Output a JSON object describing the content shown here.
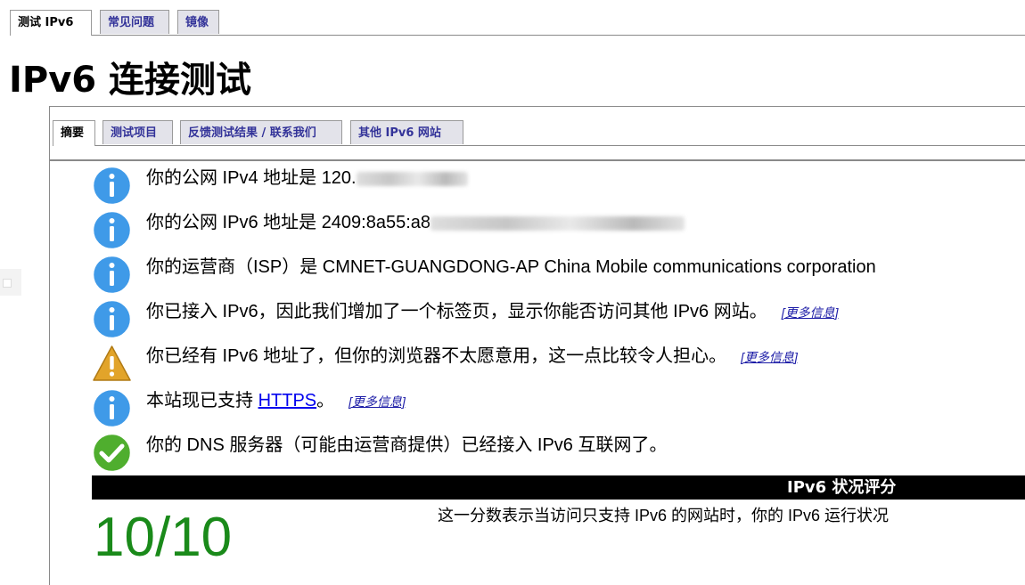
{
  "top_tabs": [
    {
      "label": "测试 IPv6",
      "active": true
    },
    {
      "label": "常见问题",
      "active": false
    },
    {
      "label": "镜像",
      "active": false
    }
  ],
  "title": "IPv6 连接测试",
  "inner_tabs": [
    {
      "label": "摘要",
      "active": true
    },
    {
      "label": "测试项目",
      "active": false
    },
    {
      "label": "反馈测试结果 / 联系我们",
      "active": false
    },
    {
      "label": "其他 IPv6 网站",
      "active": false
    }
  ],
  "messages": [
    {
      "icon": "info-icon",
      "text": "你的公网 IPv4 地址是 120."
    },
    {
      "icon": "info-icon",
      "text": "你的公网 IPv6 地址是 2409:8a55:a8"
    },
    {
      "icon": "info-icon",
      "text": "你的运营商（ISP）是 CMNET-GUANGDONG-AP China Mobile communications corporation"
    },
    {
      "icon": "info-icon",
      "text": "你已接入 IPv6，因此我们增加了一个标签页，显示你能否访问其他 IPv6 网站。",
      "more": "[更多信息]"
    },
    {
      "icon": "warning-icon",
      "text": "你已经有 IPv6 地址了，但你的浏览器不太愿意用，这一点比较令人担心。",
      "more": "[更多信息]"
    },
    {
      "icon": "info-icon",
      "text_before": "本站现已支持 ",
      "link": "HTTPS",
      "text_after": "。",
      "more": "[更多信息]"
    },
    {
      "icon": "check-icon",
      "text": "你的 DNS 服务器（可能由运营商提供）已经接入 IPv6 互联网了。"
    }
  ],
  "score": {
    "heading": "IPv6 状况评分",
    "value": "10/10",
    "description": "这一分数表示当访问只支持 IPv6 的网站时，你的 IPv6 运行状况"
  },
  "colors": {
    "tab_text": "#333399",
    "score": "#1a8a1a",
    "info": "#3f9ae8",
    "warning": "#e2a42a",
    "check": "#4fae2e"
  }
}
